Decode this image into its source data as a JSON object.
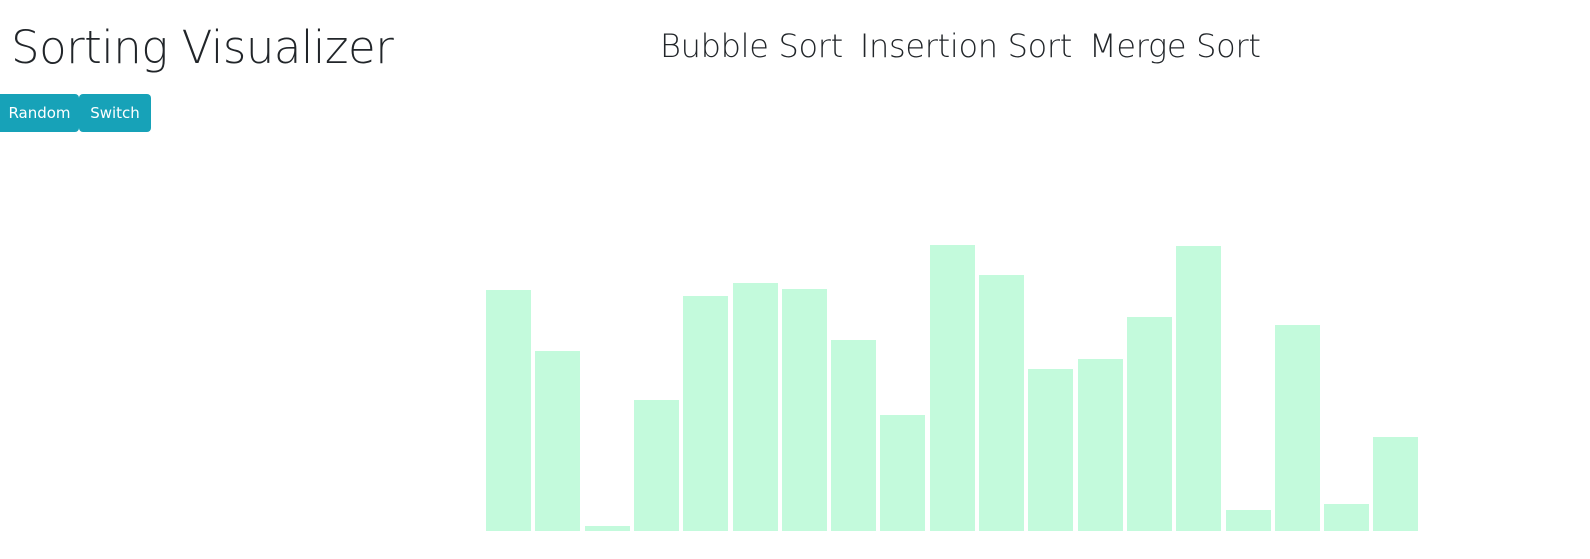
{
  "header": {
    "title": "Sorting Visualizer"
  },
  "nav": {
    "items": [
      {
        "label": "Bubble Sort"
      },
      {
        "label": "Insertion Sort"
      },
      {
        "label": "Merge Sort"
      }
    ]
  },
  "controls": {
    "random_label": "Random",
    "switch_label": "Switch"
  },
  "colors": {
    "bar": "#c3fadc",
    "button": "#17a2b8"
  },
  "array": {
    "values": [
      241,
      180,
      5,
      131,
      235,
      248,
      242,
      191,
      116,
      286,
      256,
      162,
      172,
      214,
      285,
      21,
      206,
      27,
      94
    ]
  }
}
